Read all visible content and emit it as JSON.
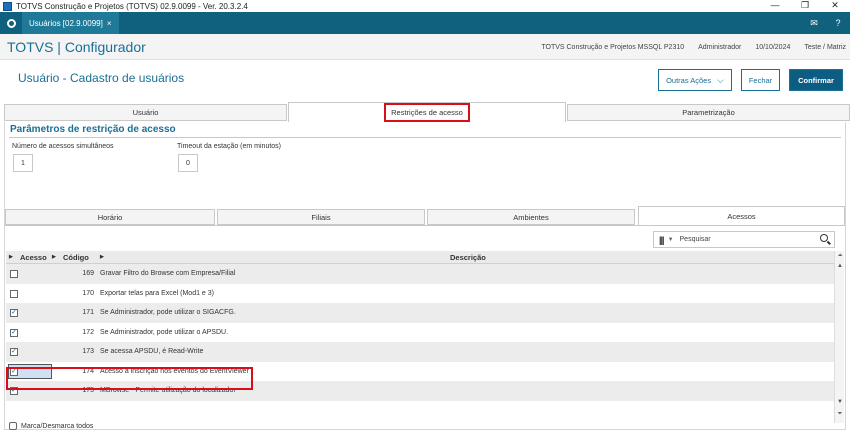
{
  "window": {
    "title": "TOTVS Construção e Projetos (TOTVS) 02.9.0099 - Ver. 20.3.2.4",
    "minimize": "—",
    "maximize": "❐",
    "close": "✕"
  },
  "tabstrip": {
    "doc_tab": "Usuários [02.9.0099]",
    "doc_tab_close": "×"
  },
  "appheader": {
    "brand": "TOTVS | Configurador",
    "environment": "TOTVS Construção e Projetos MSSQL P2310",
    "user": "Administrador",
    "date": "10/10/2024",
    "branch": "Teste / Matriz"
  },
  "page": {
    "title": "Usuário - Cadastro de usuários",
    "other_actions": "Outras Ações",
    "close_button": "Fechar",
    "confirm_button": "Confirmar"
  },
  "main_tabs": [
    {
      "label": "Usuário"
    },
    {
      "label": "Restrições de acesso"
    },
    {
      "label": "Parametrização"
    }
  ],
  "section": {
    "title": "Parâmetros de restrição de acesso",
    "simultaneous_label": "Número de acessos simultâneos",
    "simultaneous_value": "1",
    "timeout_label": "Timeout da estação (em minutos)",
    "timeout_value": "0"
  },
  "sub_tabs": [
    {
      "label": "Horário"
    },
    {
      "label": "Filiais"
    },
    {
      "label": "Ambientes"
    },
    {
      "label": "Acessos"
    }
  ],
  "grid": {
    "search_placeholder": "Pesquisar",
    "columns": {
      "access": "Acesso",
      "code": "Código",
      "description": "Descrição"
    },
    "rows": [
      {
        "checked": false,
        "code": "169",
        "description": "Gravar Filtro do Browse com Empresa/Filial"
      },
      {
        "checked": false,
        "code": "170",
        "description": "Exportar telas para Excel (Mod1 e 3)"
      },
      {
        "checked": true,
        "code": "171",
        "description": "Se Administrador, pode utilizar o SIGACFG."
      },
      {
        "checked": true,
        "code": "172",
        "description": "Se Administrador, pode utilizar o APSDU."
      },
      {
        "checked": true,
        "code": "173",
        "description": "Se acessa APSDU, é Read-Write"
      },
      {
        "checked": true,
        "code": "174",
        "description": "Acesso a inscrição nos eventos do EventViewer"
      },
      {
        "checked": true,
        "code": "175",
        "description": "MBrowse - Permite utilização do localizador"
      }
    ]
  },
  "footer": {
    "toggle_all": "Marca/Desmarca todos"
  }
}
